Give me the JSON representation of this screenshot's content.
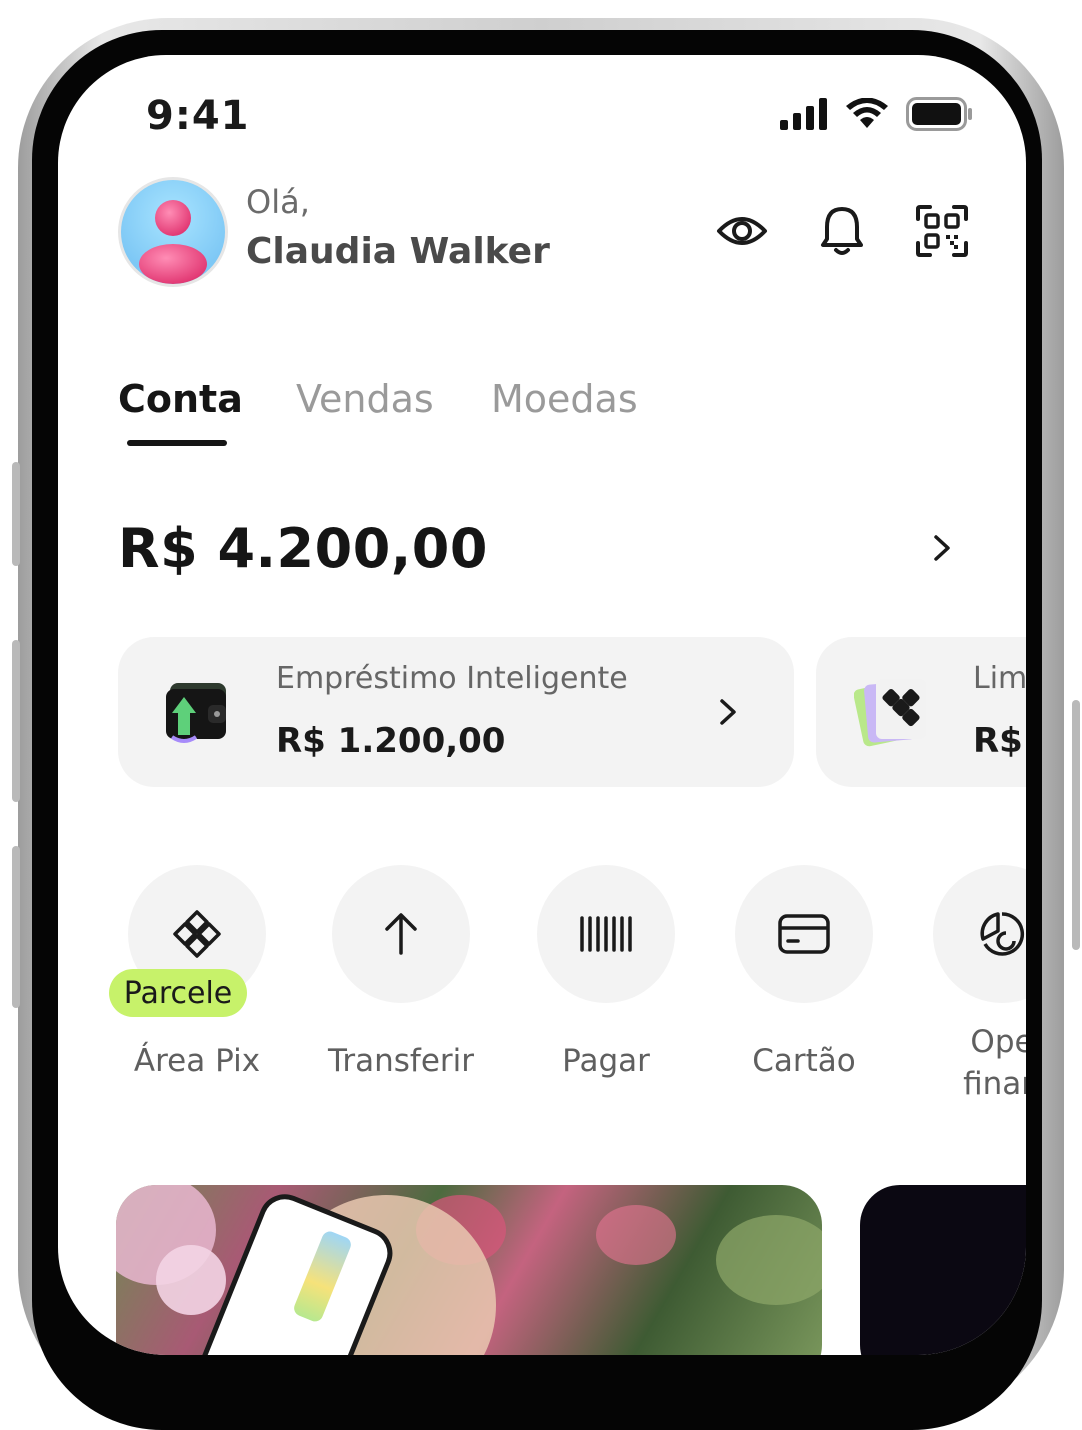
{
  "status_bar": {
    "time": "9:41"
  },
  "header": {
    "greeting": "Olá,",
    "user_name": "Claudia Walker"
  },
  "tabs": [
    {
      "label": "Conta",
      "active": true
    },
    {
      "label": "Vendas",
      "active": false
    },
    {
      "label": "Moedas",
      "active": false
    }
  ],
  "balance": {
    "amount": "R$ 4.200,00"
  },
  "cards": [
    {
      "title": "Empréstimo Inteligente",
      "amount": "R$ 1.200,00",
      "icon": "wallet-icon"
    },
    {
      "title": "Lim",
      "amount": "R$",
      "icon": "pix-cards-icon"
    }
  ],
  "quick_actions": [
    {
      "label": "Área Pix",
      "icon": "pix-icon",
      "badge": "Parcele"
    },
    {
      "label": "Transferir",
      "icon": "arrow-up-icon"
    },
    {
      "label": "Pagar",
      "icon": "barcode-icon"
    },
    {
      "label": "Cartão",
      "icon": "card-icon"
    },
    {
      "label_line1": "Ope",
      "label_line2": "finan",
      "icon": "chart-icon"
    }
  ],
  "colors": {
    "accent_lime": "#c7f26a",
    "surface_gray": "#f3f3f3",
    "text_primary": "#151515",
    "text_secondary": "#9a9a9a"
  }
}
